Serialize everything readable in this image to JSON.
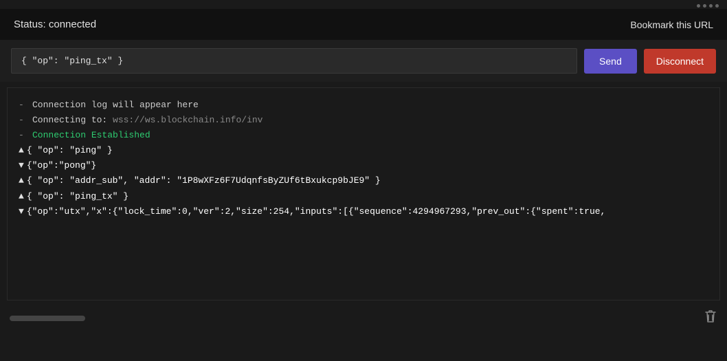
{
  "header": {
    "status_label": "Status: connected",
    "bookmark_label": "Bookmark this URL"
  },
  "toolbar": {
    "input_value": "{ \"op\": \"ping_tx\" }",
    "input_placeholder": "{ \"op\": \"ping_tx\" }",
    "send_label": "Send",
    "disconnect_label": "Disconnect"
  },
  "log": {
    "lines": [
      {
        "prefix": "-",
        "type": "normal",
        "text": "Connection log will appear here"
      },
      {
        "prefix": "-",
        "type": "normal",
        "text": "Connecting to: ",
        "url": "wss://ws.blockchain.info/inv"
      },
      {
        "prefix": "-",
        "type": "green",
        "text": "Connection Established"
      },
      {
        "prefix": "▲",
        "type": "white",
        "text": "{   \"op\": \"ping\" }"
      },
      {
        "prefix": "▼",
        "type": "white",
        "text": "{\"op\":\"pong\"}"
      },
      {
        "prefix": "▲",
        "type": "white",
        "text": "{   \"op\": \"addr_sub\",   \"addr\": \"1P8wXFz6F7UdqnfsByZUf6tBxukcp9bJE9\" }"
      },
      {
        "prefix": "▲",
        "type": "white",
        "text": "{   \"op\": \"ping_tx\" }"
      },
      {
        "prefix": "▼",
        "type": "white",
        "text": "{\"op\":\"utx\",\"x\":{\"lock_time\":0,\"ver\":2,\"size\":254,\"inputs\":[{\"sequence\":4294967293,\"prev_out\":{\"spent\":true,"
      }
    ],
    "scroll_label": "",
    "clear_label": "clear"
  },
  "dots": [
    "dot",
    "dot",
    "dot",
    "dot"
  ]
}
